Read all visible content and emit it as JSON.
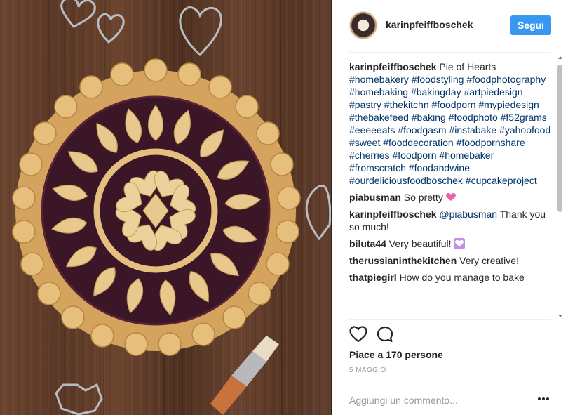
{
  "post": {
    "username": "karinpfeiffboschek",
    "follow_label": "Segui"
  },
  "caption": {
    "username": "karinpfeiffboschek",
    "text": "Pie of Hearts",
    "hashtags": "#homebakery #foodstyling #foodphotography #homebaking #bakingday #artpiedesign #pastry #thekitchn #foodporn #mypiedesign #thebakefeed #baking #foodphoto #f52grams #eeeeeats #foodgasm #instabake #yahoofood #sweet #fooddecoration #foodpornshare #cherries #foodporn #homebaker #fromscratch #foodandwine #ourdeliciousfoodboschek #cupcakeproject"
  },
  "comments": [
    {
      "username": "piabusman",
      "text": "So pretty",
      "emoji": "heart-icon"
    },
    {
      "username": "karinpfeiffboschek",
      "mention": "@piabusman",
      "text": "Thank you so much!"
    },
    {
      "username": "biluta44",
      "text": "Very beautiful!",
      "emoji": "heart-box-icon"
    },
    {
      "username": "therussianinthekitchen",
      "text": "Very creative!"
    },
    {
      "username": "thatpiegirl",
      "text": "How do you manage to bake"
    }
  ],
  "likes_text": "Piace a 170 persone",
  "date_text": "5 MAGGIO",
  "comment_input": {
    "placeholder": "Aggiungi un commento...",
    "value": ""
  },
  "colors": {
    "follow_button": "#3897f0",
    "hashtag": "#003569",
    "muted": "#999999",
    "text": "#262626"
  }
}
